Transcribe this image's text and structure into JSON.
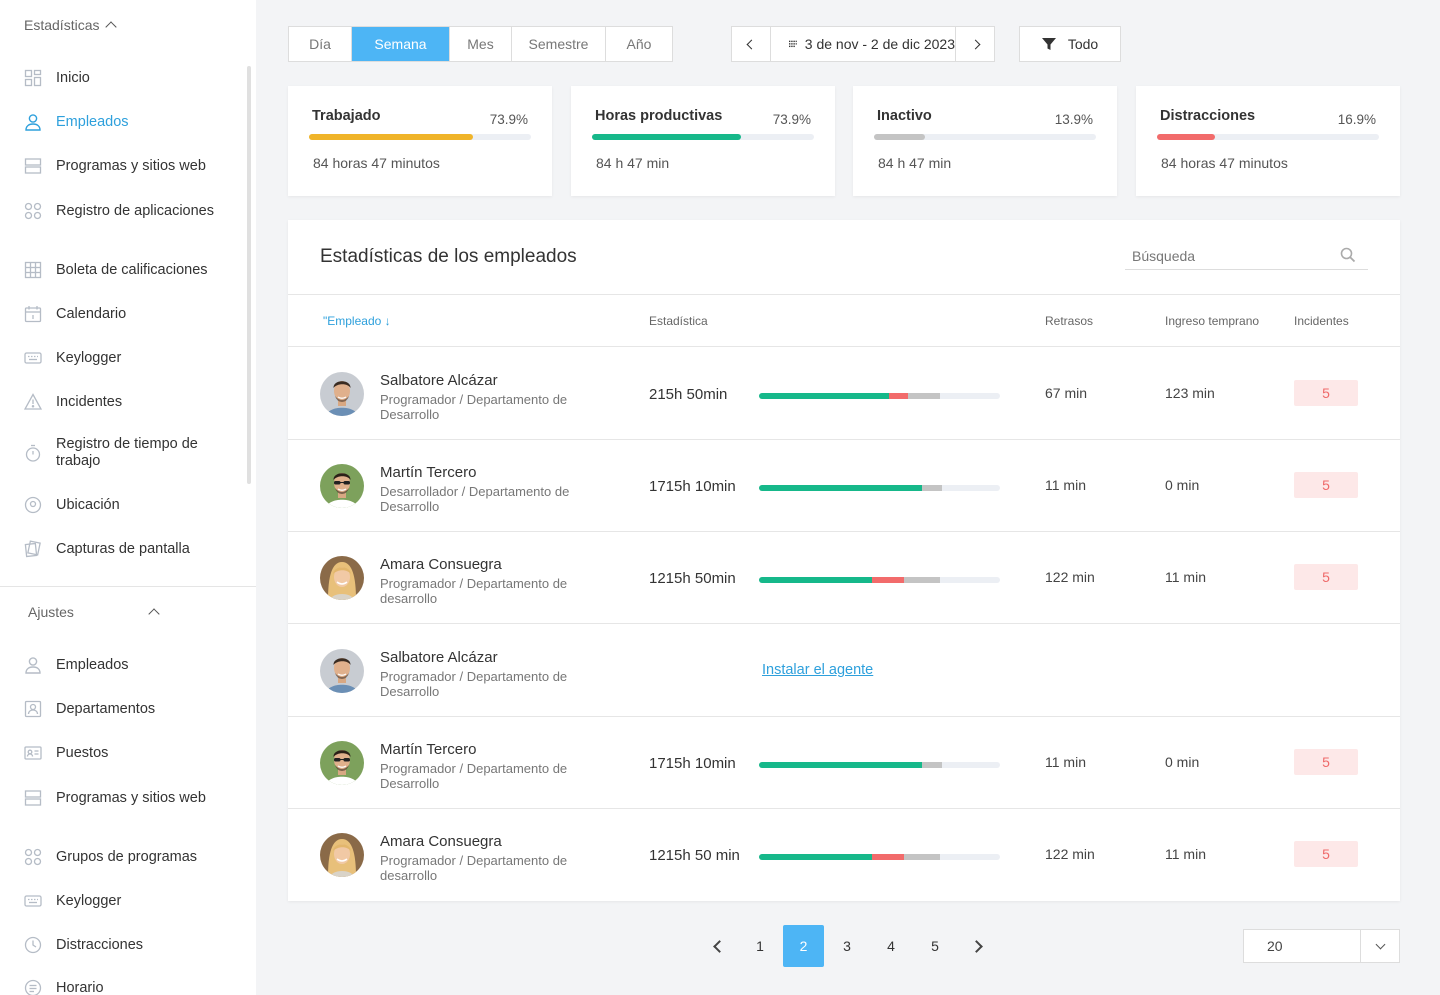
{
  "sidebar": {
    "section1_title": "Estadísticas",
    "section1_items": [
      {
        "label": "Inicio",
        "icon": "grid-icon"
      },
      {
        "label": "Empleados",
        "icon": "user-icon"
      },
      {
        "label": "Programas y sitios web",
        "icon": "window-icon"
      },
      {
        "label": "Registro de aplicaciones",
        "icon": "apps-icon"
      },
      {
        "label": "Boleta de calificaciones",
        "icon": "table-icon"
      },
      {
        "label": "Calendario",
        "icon": "calendar-icon"
      },
      {
        "label": "Keylogger",
        "icon": "keyboard-icon"
      },
      {
        "label": "Incidentes",
        "icon": "warning-icon"
      },
      {
        "label": "Registro de tiempo de trabajo",
        "icon": "stopwatch-icon"
      },
      {
        "label": "Ubicación",
        "icon": "location-icon"
      },
      {
        "label": "Capturas de pantalla",
        "icon": "screenshots-icon"
      }
    ],
    "section2_title": "Ajustes",
    "section2_items": [
      {
        "label": "Empleados",
        "icon": "user-icon"
      },
      {
        "label": "Departamentos",
        "icon": "department-icon"
      },
      {
        "label": "Puestos",
        "icon": "id-card-icon"
      },
      {
        "label": "Programas y sitios web",
        "icon": "window-icon"
      },
      {
        "label": "Grupos de programas",
        "icon": "apps-icon"
      },
      {
        "label": "Keylogger",
        "icon": "keyboard-icon"
      },
      {
        "label": "Distracciones",
        "icon": "clock-icon"
      },
      {
        "label": "Horario",
        "icon": "schedule-icon"
      }
    ]
  },
  "toolbar": {
    "periods": [
      "Día",
      "Semana",
      "Mes",
      "Semestre",
      "Año"
    ],
    "active_period": "Semana",
    "date_range": "3 de nov - 2 de dic 2023",
    "filter_label": "Todo"
  },
  "stats": [
    {
      "title": "Trabajado",
      "percent": "73.9%",
      "fraction": 0.739,
      "color": "#f0b429",
      "subtitle": "84 horas 47 minutos"
    },
    {
      "title": "Horas productivas",
      "percent": "73.9%",
      "fraction": 0.669,
      "color": "#16b88a",
      "subtitle": "84 h 47 min"
    },
    {
      "title": "Inactivo",
      "percent": "13.9%",
      "fraction": 0.23,
      "color": "#c4c4c4",
      "subtitle": "84 h 47 min"
    },
    {
      "title": "Distracciones",
      "percent": "16.9%",
      "fraction": 0.26,
      "color": "#f26b6b",
      "subtitle": "84 horas 47 minutos"
    }
  ],
  "panel": {
    "title": "Estadísticas de los empleados",
    "search_placeholder": "Búsqueda",
    "columns": {
      "employee": "\"Empleado ↓",
      "stat": "Estadística",
      "delays": "Retrasos",
      "early": "Ingreso temprano",
      "incidents": "Incidentes"
    },
    "install_agent_label": "Instalar el agente",
    "rows": [
      {
        "name": "Salbatore Alcázar",
        "role": "Programador / Departamento de Desarrollo",
        "time": "215h 50min",
        "productive": 0.54,
        "distraction": 0.08,
        "idle": 0.13,
        "delays": "67 min",
        "early": "123 min",
        "incidents": "5",
        "avatar": "man1"
      },
      {
        "name": "Martín Tercero",
        "role": "Desarrollador / Departamento de Desarrollo",
        "time": "1715h 10min",
        "productive": 0.675,
        "distraction": 0.0,
        "idle": 0.085,
        "delays": "11 min",
        "early": "0 min",
        "incidents": "5",
        "avatar": "man2"
      },
      {
        "name": "Amara Consuegra",
        "role": "Programador / Departamento de desarrollo",
        "time": "1215h 50min",
        "productive": 0.47,
        "distraction": 0.13,
        "idle": 0.15,
        "delays": "122 min",
        "early": "11 min",
        "incidents": "5",
        "avatar": "woman"
      },
      {
        "name": "Salbatore Alcázar",
        "role": "Programador / Departamento de Desarrollo",
        "install": true,
        "avatar": "man1"
      },
      {
        "name": "Martín Tercero",
        "role": "Programador / Departamento de Desarrollo",
        "time": "1715h 10min",
        "productive": 0.675,
        "distraction": 0.0,
        "idle": 0.085,
        "delays": "11 min",
        "early": "0 min",
        "incidents": "5",
        "avatar": "man2"
      },
      {
        "name": "Amara Consuegra",
        "role": "Programador / Departamento de desarrollo",
        "time": "1215h 50 min",
        "productive": 0.47,
        "distraction": 0.13,
        "idle": 0.15,
        "delays": "122 min",
        "early": "11 min",
        "incidents": "5",
        "avatar": "woman"
      }
    ]
  },
  "pagination": {
    "pages": [
      "1",
      "2",
      "3",
      "4",
      "5"
    ],
    "current": "2",
    "per_page": "20"
  },
  "colors": {
    "accent": "#4db5f5",
    "link": "#2ea0dc",
    "productive": "#16b88a",
    "distraction": "#f26b6b",
    "idle": "#c4c4c4"
  }
}
